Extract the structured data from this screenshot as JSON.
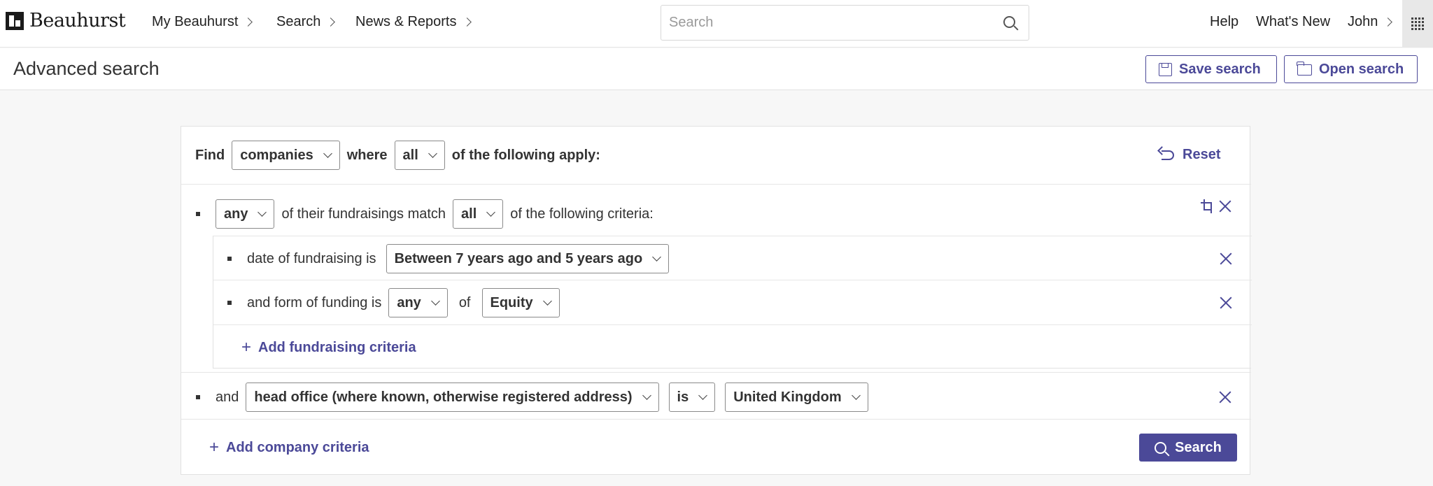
{
  "nav": {
    "logo_text": "Beauhurst",
    "items": [
      {
        "label": "My Beauhurst"
      },
      {
        "label": "Search"
      },
      {
        "label": "News & Reports"
      }
    ],
    "search_placeholder": "Search",
    "help": "Help",
    "whats_new": "What's New",
    "user": "John"
  },
  "header": {
    "title": "Advanced search",
    "save_label": "Save search",
    "open_label": "Open search"
  },
  "query": {
    "find_label": "Find",
    "entity": "companies",
    "where_label": "where",
    "match_mode": "all",
    "apply_label": "of the following apply:",
    "reset_label": "Reset",
    "group": {
      "quantifier": "any",
      "text": "of their fundraisings match",
      "match_mode": "all",
      "suffix": "of the following criteria:",
      "criteria": [
        {
          "label": "date of fundraising is",
          "value": "Between 7 years ago and 5 years ago"
        },
        {
          "label": "and form of funding is",
          "quantifier": "any",
          "of_label": "of",
          "value": "Equity"
        }
      ],
      "add_label": "Add fundraising criteria"
    },
    "company_criterion": {
      "prefix": "and",
      "field": "head office (where known, otherwise registered address)",
      "operator": "is",
      "value": "United Kingdom"
    },
    "add_company_label": "Add company criteria",
    "search_label": "Search"
  },
  "colors": {
    "accent": "#4b4998",
    "border": "#8a8a8a",
    "background": "#f7f7f7"
  }
}
